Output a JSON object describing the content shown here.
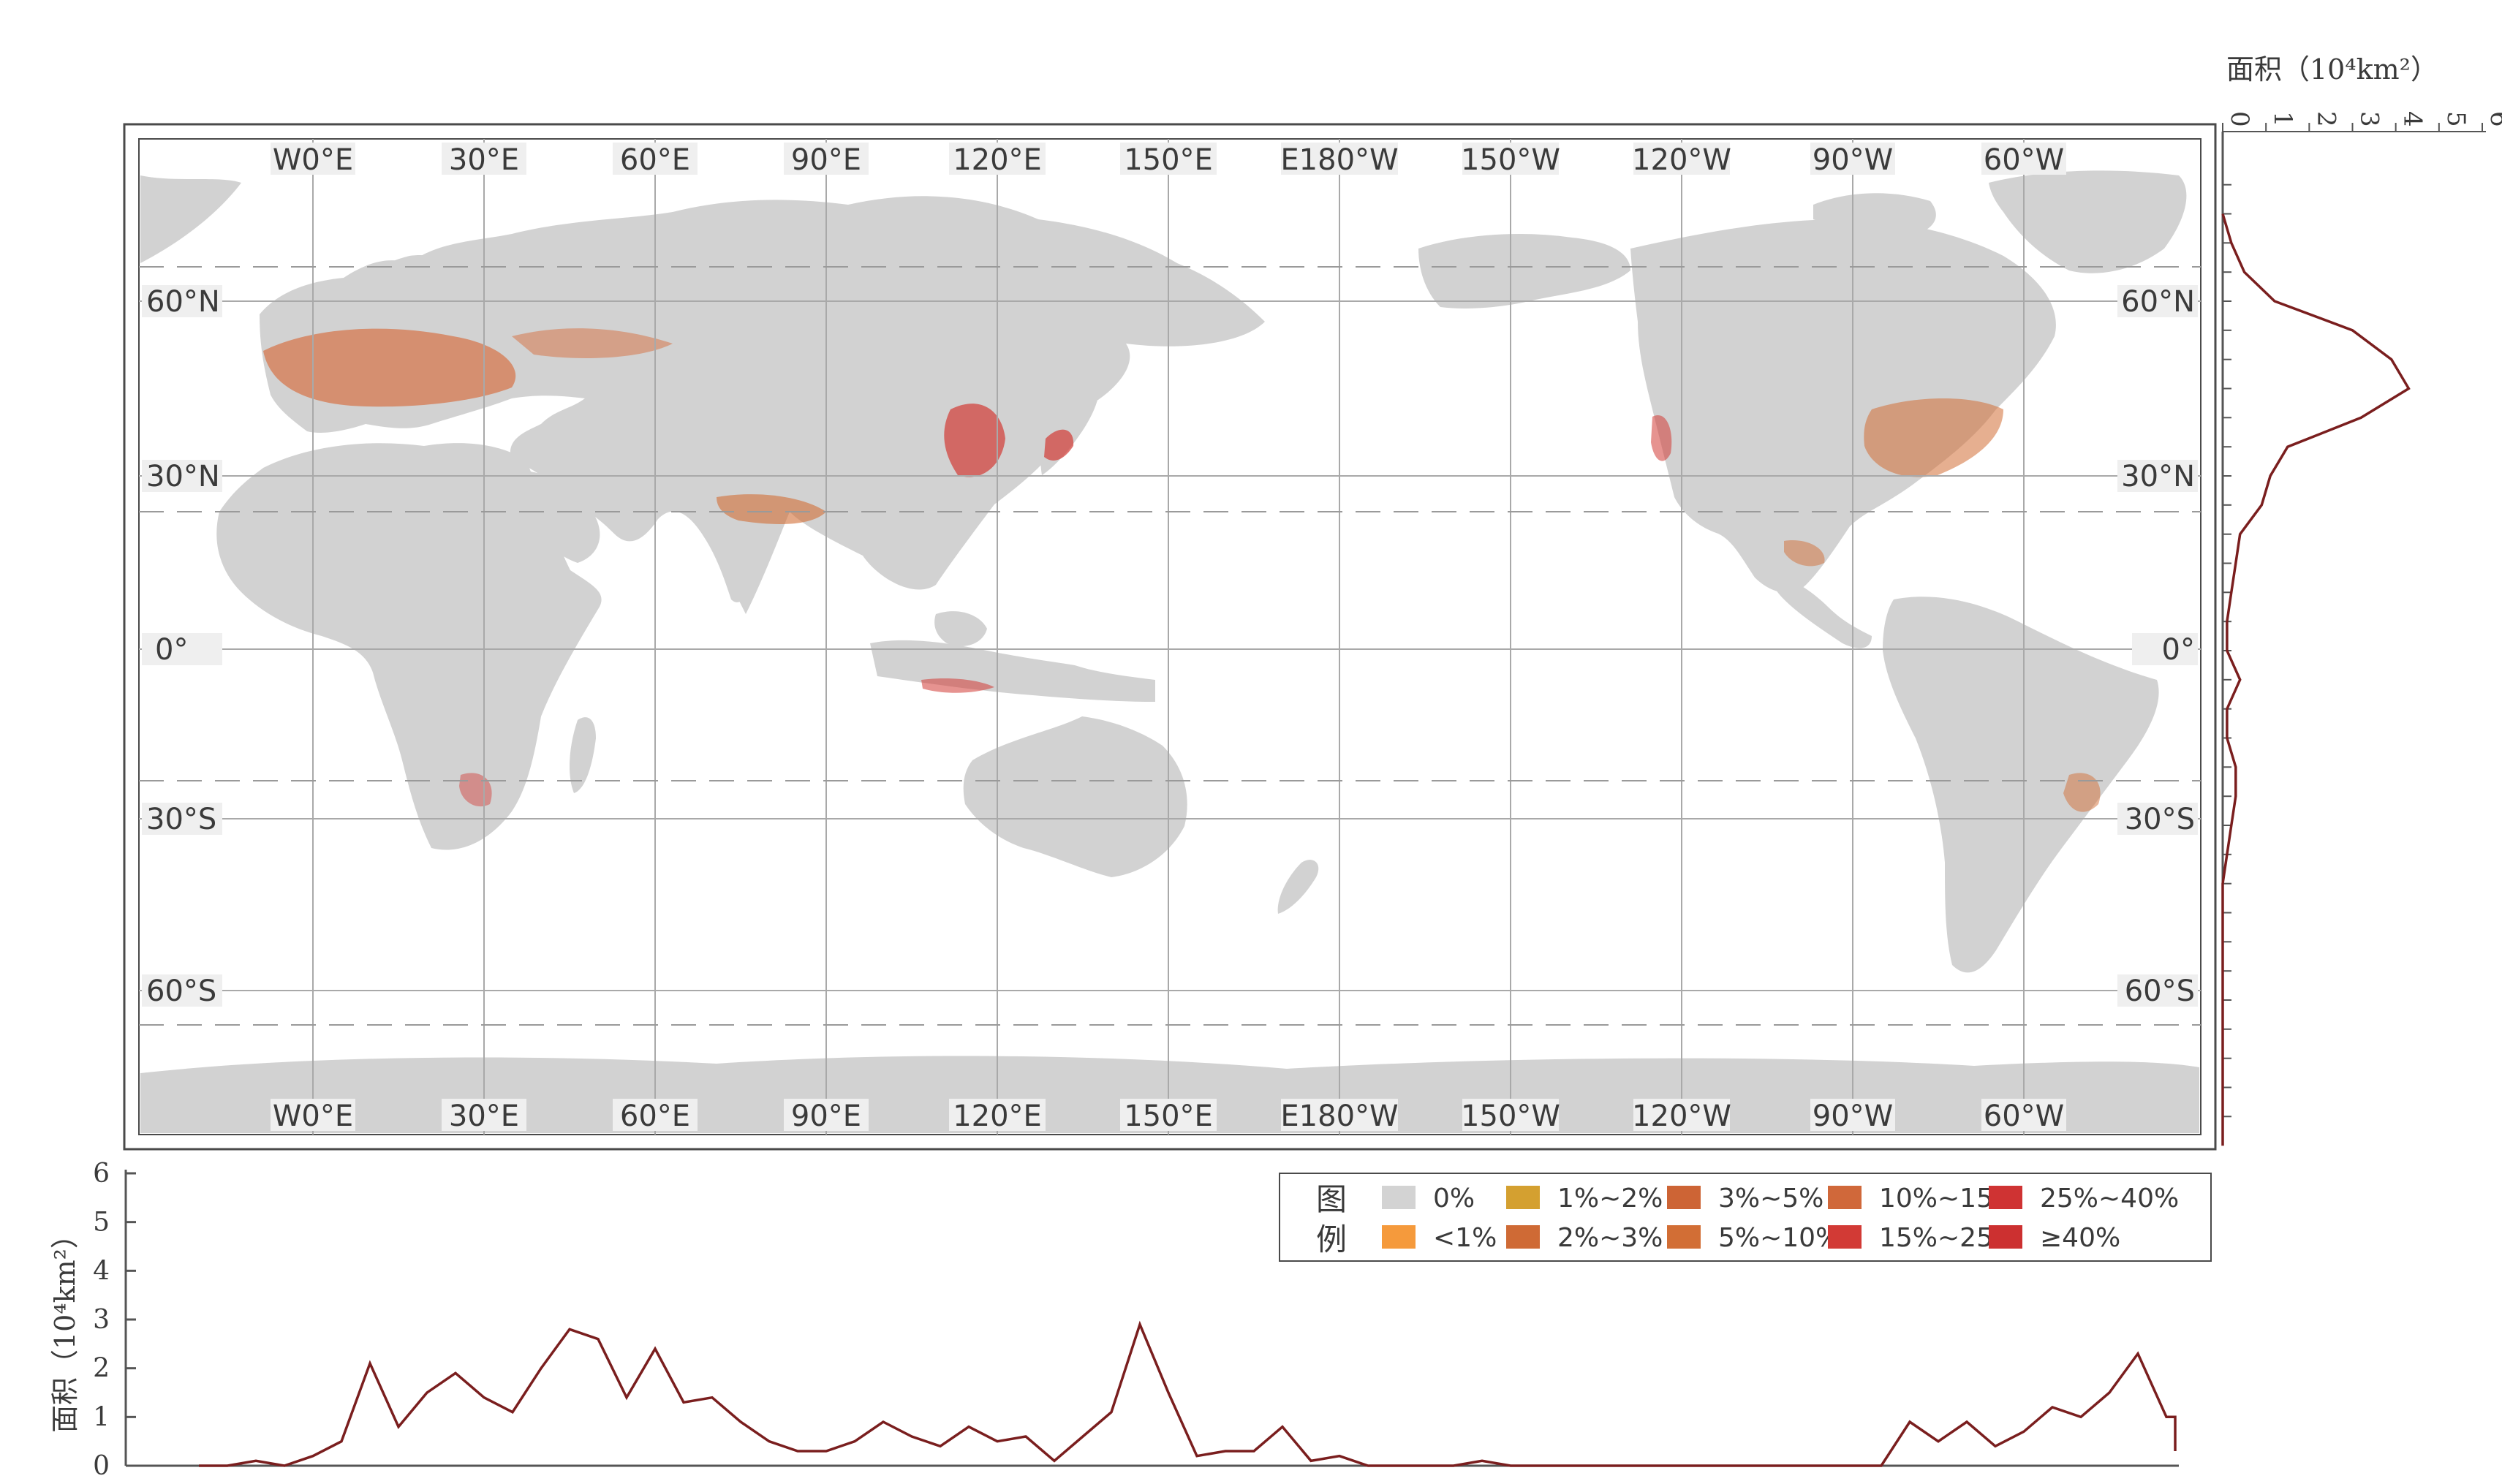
{
  "colors": {
    "land": "#d2d2d2",
    "ocean": "#ffffff",
    "grid": "#a9a9a9",
    "frame": "#4a4a4a",
    "profile_line": "#7a1e1e",
    "label_bg": "#efefef"
  },
  "map": {
    "top_lon_labels": [
      "W0°E",
      "30°E",
      "60°E",
      "90°E",
      "120°E",
      "150°E",
      "E180°W",
      "150°W",
      "120°W",
      "90°W",
      "60°W"
    ],
    "bottom_lon_labels": [
      "W0°E",
      "30°E",
      "60°E",
      "90°E",
      "120°E",
      "150°E",
      "E180°W",
      "150°W",
      "120°W",
      "90°W",
      "60°W"
    ],
    "lat_labels": [
      "60°N",
      "30°N",
      "0°",
      "30°S",
      "60°S"
    ]
  },
  "right_axis": {
    "title": "面积（10⁴km²）",
    "ticks": [
      "0",
      "1",
      "2",
      "3",
      "4",
      "5",
      "6"
    ]
  },
  "bottom_axis": {
    "title": "面积（10⁴km²）",
    "ticks": [
      "0",
      "1",
      "2",
      "3",
      "4",
      "5",
      "6"
    ]
  },
  "legend": {
    "title_top": "图",
    "title_bottom": "例",
    "items": [
      {
        "label": "0%",
        "color": "#d3d3d3"
      },
      {
        "label": "<1%",
        "color": "#f59a3c"
      },
      {
        "label": "1%~2%",
        "color": "#d4a030"
      },
      {
        "label": "2%~3%",
        "color": "#cf6a35"
      },
      {
        "label": "3%~5%",
        "color": "#cd6435"
      },
      {
        "label": "5%~10%",
        "color": "#d26e35"
      },
      {
        "label": "10%~15%",
        "color": "#d0683a"
      },
      {
        "label": "15%~25%",
        "color": "#d23a35"
      },
      {
        "label": "25%~40%",
        "color": "#cf3333"
      },
      {
        "label": "≥40%",
        "color": "#cc3030"
      }
    ]
  },
  "chart_data": [
    {
      "type": "line",
      "xlabel": "",
      "ylabel": "面积（10⁴km²）",
      "ylim": [
        0,
        6
      ],
      "x": [
        -20,
        -15,
        -10,
        -5,
        0,
        5,
        10,
        15,
        20,
        25,
        30,
        35,
        40,
        45,
        50,
        55,
        60,
        65,
        70,
        75,
        80,
        85,
        90,
        95,
        100,
        105,
        110,
        115,
        120,
        125,
        130,
        135,
        140,
        145,
        150,
        155,
        160,
        165,
        170,
        175,
        180,
        185,
        190,
        195,
        200,
        205,
        210,
        215,
        220,
        225,
        230,
        235,
        240,
        245,
        250,
        255,
        260,
        265,
        270,
        275,
        280,
        285,
        290,
        295,
        300,
        305,
        310,
        315,
        320,
        325,
        330,
        335
      ],
      "values": [
        0,
        0,
        0.1,
        0,
        0.2,
        0.5,
        2.1,
        0.8,
        1.5,
        1.9,
        1.4,
        1.1,
        2.0,
        2.8,
        2.6,
        1.4,
        2.4,
        1.3,
        1.4,
        0.9,
        0.5,
        0.3,
        0.3,
        0.5,
        0.9,
        0.6,
        0.4,
        0.8,
        0.5,
        0.6,
        0.1,
        0.6,
        1.1,
        2.9,
        1.5,
        0.2,
        0.3,
        0.3,
        0.8,
        0.1,
        0.2,
        0,
        0,
        0,
        0,
        0.1,
        0,
        0,
        0,
        0,
        0,
        0,
        0,
        0,
        0,
        0,
        0,
        0,
        0,
        0,
        0.9,
        0.5,
        0.9,
        0.4,
        0.7,
        1.2,
        1.0,
        1.5,
        2.3,
        1.0,
        1.0,
        0.3,
        0.2,
        0.2,
        0.5,
        0.1,
        0.1,
        0
      ]
    },
    {
      "type": "line",
      "xlabel": "面积（10⁴km²）",
      "ylabel": "",
      "xlim": [
        0,
        6
      ],
      "y": [
        75,
        70,
        65,
        60,
        55,
        50,
        45,
        40,
        35,
        30,
        25,
        20,
        15,
        10,
        5,
        0,
        -5,
        -10,
        -15,
        -20,
        -25,
        -30,
        -35,
        -40,
        -45,
        -50,
        -55,
        -60,
        -65,
        -70,
        -75,
        -80,
        -85
      ],
      "values": [
        0,
        0.2,
        0.5,
        1.2,
        3.0,
        3.9,
        4.3,
        3.2,
        1.5,
        1.1,
        0.9,
        0.4,
        0.3,
        0.2,
        0.1,
        0.1,
        0.4,
        0.1,
        0.1,
        0.3,
        0.3,
        0.2,
        0.1,
        0,
        0,
        0,
        0,
        0,
        0,
        0,
        0,
        0,
        0
      ]
    }
  ]
}
